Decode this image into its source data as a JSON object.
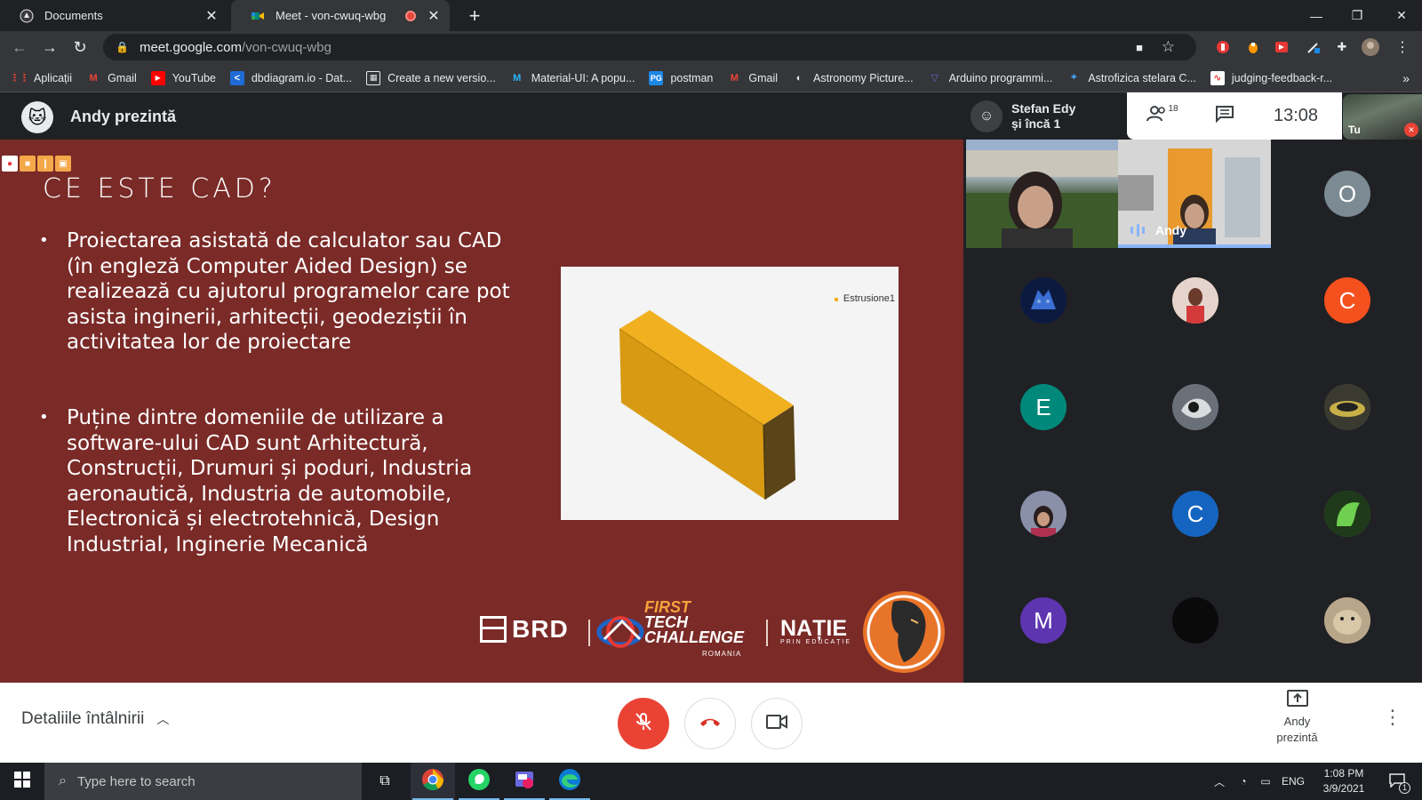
{
  "browser": {
    "tabs": [
      {
        "title": "Documents",
        "active": false
      },
      {
        "title": "Meet - von-cwuq-wbg",
        "active": true
      }
    ],
    "url_host": "meet.google.com",
    "url_path": "/von-cwuq-wbg",
    "bookmarks": [
      {
        "label": "Aplicații",
        "icon": "apps-grid-icon"
      },
      {
        "label": "Gmail",
        "icon": "gmail-icon"
      },
      {
        "label": "YouTube",
        "icon": "youtube-icon"
      },
      {
        "label": "dbdiagram.io - Dat...",
        "icon": "dbdiagram-icon"
      },
      {
        "label": "Create a new versio...",
        "icon": "calendar-icon"
      },
      {
        "label": "Material-UI: A popu...",
        "icon": "materialui-icon"
      },
      {
        "label": "postman",
        "icon": "postman-icon"
      },
      {
        "label": "Gmail",
        "icon": "gmail-icon"
      },
      {
        "label": "Astronomy Picture...",
        "icon": "astronomy-icon"
      },
      {
        "label": "Arduino programmi...",
        "icon": "arduino-icon"
      },
      {
        "label": "Astrofizica stelara C...",
        "icon": "astro-icon"
      },
      {
        "label": "judging-feedback-r...",
        "icon": "judging-icon"
      }
    ]
  },
  "meet": {
    "presenter_title": "Andy prezintă",
    "active_speaker": {
      "line1": "Stefan Edy",
      "line2": "și încă 1"
    },
    "participants_count": "18",
    "time": "13:08",
    "self_label": "Tu",
    "tiles": [
      {
        "name": ""
      },
      {
        "name": "Andy"
      }
    ],
    "avatars": [
      {
        "initial": "O",
        "color": "#7b8a93"
      },
      {
        "initial": "",
        "color": "#1a2a5a"
      },
      {
        "initial": "",
        "color": "#d9a59a"
      },
      {
        "initial": "C",
        "color": "#f4511e"
      },
      {
        "initial": "E",
        "color": "#00897b"
      },
      {
        "initial": "",
        "color": "#4a5560"
      },
      {
        "initial": "",
        "color": "#5a5a4a"
      },
      {
        "initial": "",
        "color": "#5a6075"
      },
      {
        "initial": "C",
        "color": "#1565c0"
      },
      {
        "initial": "",
        "color": "#3f7a3a"
      },
      {
        "initial": "M",
        "color": "#5e35b1"
      },
      {
        "initial": "",
        "color": "#0a0a0a"
      },
      {
        "initial": "",
        "color": "#b8a68a"
      }
    ],
    "bottom": {
      "details": "Detaliile întâlnirii",
      "present_line1": "Andy",
      "present_line2": "prezintă"
    }
  },
  "slide": {
    "title": "CE ESTE CAD?",
    "bullets": [
      "Proiectarea asistată de calculator sau CAD (în engleză Computer Aided Design) se realizează cu ajutorul programelor care pot asista inginerii, arhitecții, geodeziștii în activitatea lor de proiectare",
      "Puține dintre domeniile de utilizare a software-ului CAD sunt  Arhitectură, Construcții, Drumuri și poduri, Industria aeronautică, Industria de automobile, Electronică și electrotehnică, Design Industrial, Inginerie Mecanică"
    ],
    "image_label": "Estrusione1",
    "logos": {
      "brd": "BRD",
      "ftc_line1": "FIRST",
      "ftc_line2": "TECH",
      "ftc_line3": "CHALLENGE",
      "ftc_country": "ROMANIA",
      "natie": "NAȚIE",
      "natie_sub": "PRIN EDUCAȚIE"
    }
  },
  "taskbar": {
    "search_placeholder": "Type here to search",
    "lang": "ENG",
    "time": "1:08 PM",
    "date": "3/9/2021",
    "notifications": "1"
  }
}
